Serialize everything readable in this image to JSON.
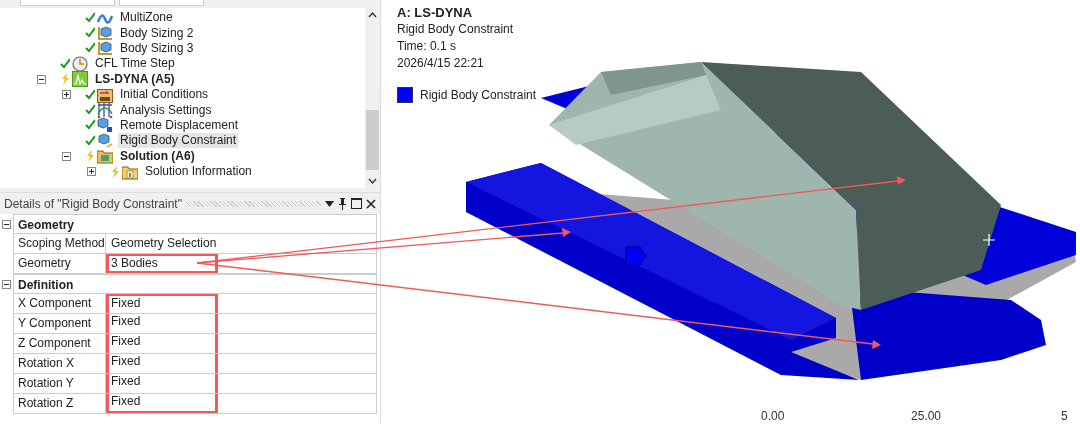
{
  "tree": {
    "items": [
      {
        "children": [
          {
            "label": "MultiZone",
            "kind": "multizone",
            "solved": true,
            "selected": false,
            "bold": false
          },
          {
            "label": "Body Sizing 2",
            "kind": "sizing",
            "solved": true,
            "selected": false,
            "bold": false
          },
          {
            "label": "Body Sizing 3",
            "kind": "sizing",
            "solved": true,
            "selected": false,
            "bold": false
          }
        ]
      },
      {
        "label": "CFL Time Step",
        "kind": "clock",
        "solved": true,
        "selected": false,
        "bold": false
      },
      {
        "label": "LS-DYNA (A5)",
        "kind": "analysis",
        "solved": false,
        "selected": false,
        "bold": true,
        "expanded": true,
        "children": [
          {
            "label": "Initial Conditions",
            "kind": "initial",
            "solved": true,
            "selected": false,
            "bold": false,
            "expanded": false
          },
          {
            "label": "Analysis Settings",
            "kind": "settings",
            "solved": true,
            "selected": false,
            "bold": false
          },
          {
            "label": "Remote Displacement",
            "kind": "remote",
            "solved": true,
            "selected": false,
            "bold": false
          },
          {
            "label": "Rigid Body Constraint",
            "kind": "rigid",
            "solved": true,
            "selected": true,
            "bold": false
          },
          {
            "label": "Solution (A6)",
            "kind": "solution",
            "solved": false,
            "selected": false,
            "bold": true,
            "expanded": true,
            "children": [
              {
                "label": "Solution Information",
                "kind": "info",
                "solved": false,
                "selected": false,
                "bold": false,
                "expanded": false
              }
            ]
          }
        ]
      }
    ]
  },
  "details": {
    "title": "Details of \"Rigid Body Constraint\"",
    "groups": [
      {
        "label": "Geometry",
        "expanded": true,
        "rows": [
          {
            "name": "Scoping Method",
            "value": "Geometry Selection",
            "highlighted": false
          },
          {
            "name": "Geometry",
            "value": "3 Bodies",
            "highlighted": true
          }
        ]
      },
      {
        "label": "Definition",
        "expanded": true,
        "rows": [
          {
            "name": "X Component",
            "value": "Fixed",
            "highlighted": true
          },
          {
            "name": "Y Component",
            "value": "Fixed",
            "highlighted": true
          },
          {
            "name": "Z Component",
            "value": "Fixed",
            "highlighted": true
          },
          {
            "name": "Rotation X",
            "value": "Fixed",
            "highlighted": true
          },
          {
            "name": "Rotation Y",
            "value": "Fixed",
            "highlighted": true
          },
          {
            "name": "Rotation Z",
            "value": "Fixed",
            "highlighted": true
          }
        ]
      }
    ]
  },
  "viewport": {
    "title": "A: LS-DYNA",
    "lines": [
      "Rigid Body Constraint",
      "Time: 0.1 s",
      "2026/4/15 22:21"
    ],
    "legend": [
      {
        "label": "Rigid Body Constraint",
        "color": "#0000ff"
      }
    ],
    "scale": [
      "0.00",
      "25.00",
      "5"
    ]
  }
}
